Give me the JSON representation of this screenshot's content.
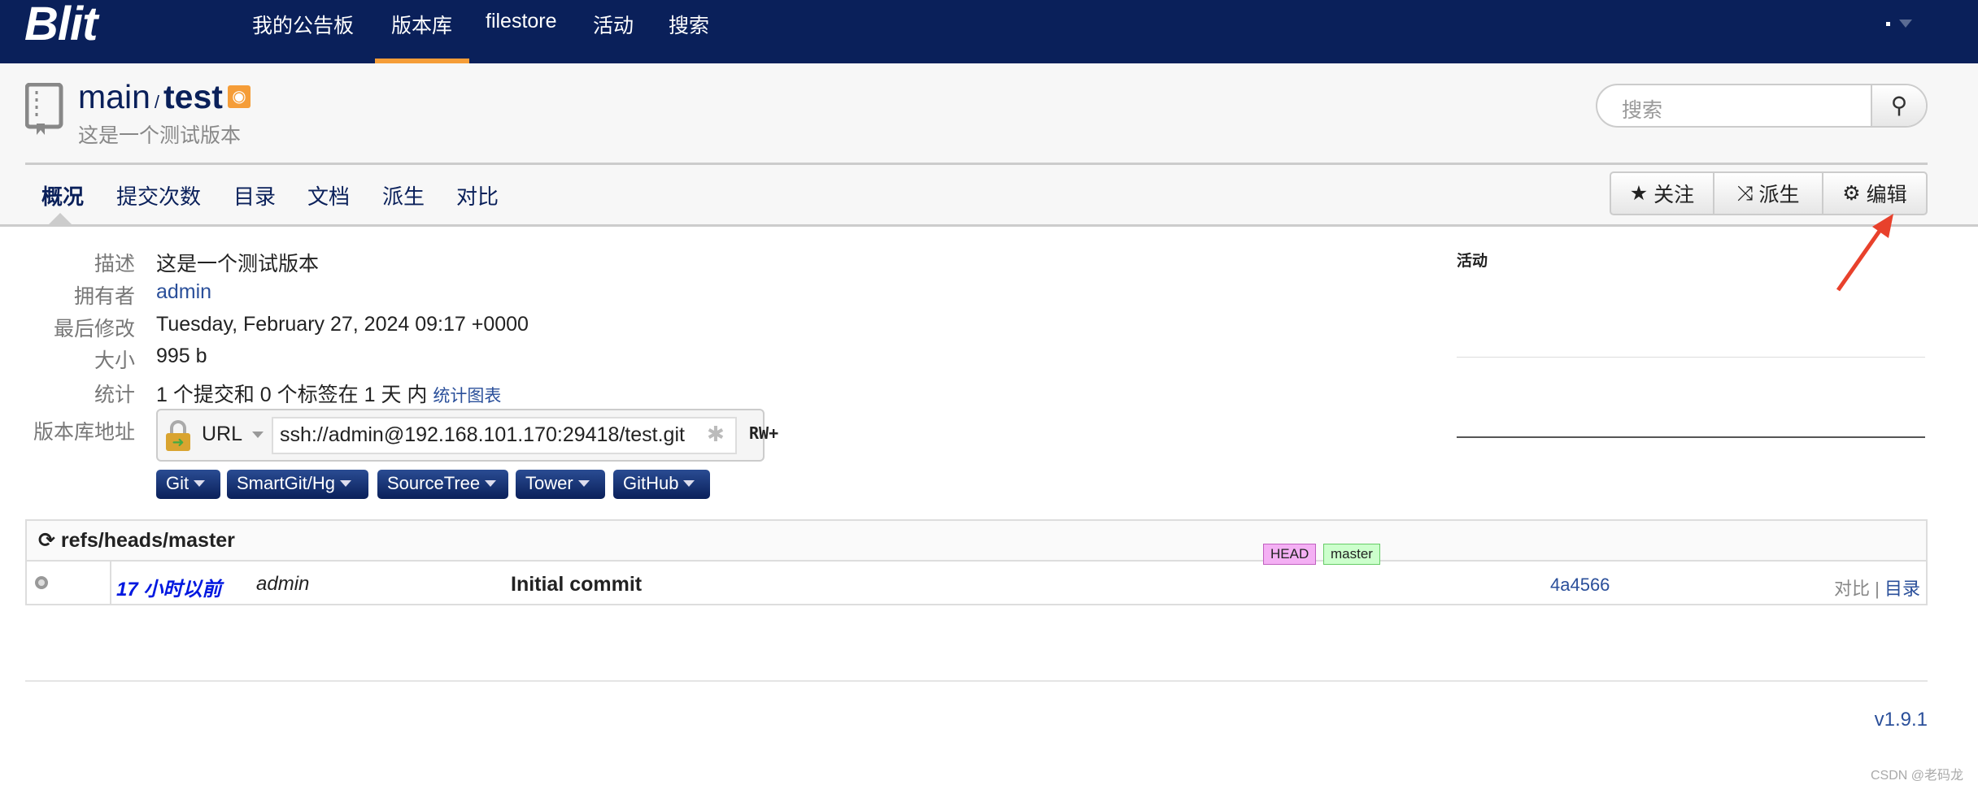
{
  "navbar": {
    "logo": "Blit",
    "items": [
      "我的公告板",
      "版本库",
      "filestore",
      "活动",
      "搜索"
    ],
    "active": "版本库"
  },
  "header": {
    "project": "main",
    "separator": "/",
    "repo": "test",
    "description": "这是一个测试版本",
    "search_placeholder": "搜索"
  },
  "tabs": [
    "概况",
    "提交次数",
    "目录",
    "文档",
    "派生",
    "对比"
  ],
  "actions": {
    "watch": "关注",
    "fork": "派生",
    "edit": "编辑"
  },
  "summary": {
    "labels": {
      "description": "描述",
      "owner": "拥有者",
      "last_change": "最后修改",
      "size": "大小",
      "stats": "统计",
      "url": "版本库地址"
    },
    "description": "这是一个测试版本",
    "owner": "admin",
    "last_change": "Tuesday, February 27, 2024 09:17 +0000",
    "size": "995 b",
    "stats": "1 个提交和 0 个标签在 1 天 内",
    "stats_link": "统计图表",
    "url_protocol": "URL",
    "url": "ssh://admin@192.168.101.170:29418/test.git",
    "permission": "RW+"
  },
  "activity_label": "活动",
  "clients": [
    "Git",
    "SmartGit/Hg",
    "SourceTree",
    "Tower",
    "GitHub"
  ],
  "log": {
    "ref": "refs/heads/master",
    "rows": [
      {
        "age": "17 小时以前",
        "author": "admin",
        "message": "Initial commit",
        "refs": [
          "HEAD",
          "master"
        ],
        "id": "4a4566",
        "links": [
          "对比",
          "目录"
        ],
        "sep": "|"
      }
    ]
  },
  "footer": {
    "version": "v1.9.1",
    "watermark": "CSDN @老码龙"
  },
  "colors": {
    "navbar": "#0a205a",
    "accent": "#f59d38",
    "link": "#2a4f9a"
  }
}
